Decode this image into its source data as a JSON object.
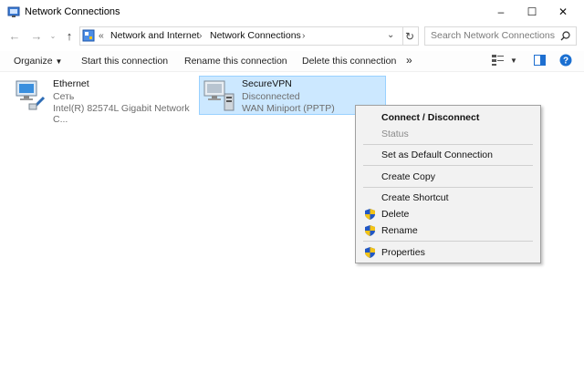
{
  "window": {
    "title": "Network Connections",
    "controls": {
      "minimize": "–",
      "maximize": "☐",
      "close": "✕"
    }
  },
  "address": {
    "overflow": "«",
    "crumbs": [
      "Network and Internet",
      "Network Connections"
    ],
    "separator": "›",
    "search_placeholder": "Search Network Connections"
  },
  "commands": {
    "organize": "Organize",
    "start": "Start this connection",
    "rename": "Rename this connection",
    "delete": "Delete this connection",
    "more": "»"
  },
  "items": [
    {
      "name": "Ethernet",
      "status": "Сеть",
      "device": "Intel(R) 82574L Gigabit Network C..."
    },
    {
      "name": "SecureVPN",
      "status": "Disconnected",
      "device": "WAN Miniport (PPTP)"
    }
  ],
  "context_menu": {
    "connect": "Connect / Disconnect",
    "status": "Status",
    "set_default": "Set as Default Connection",
    "create_copy": "Create Copy",
    "create_shortcut": "Create Shortcut",
    "delete": "Delete",
    "rename": "Rename",
    "properties": "Properties"
  },
  "colors": {
    "selection": "#cce8ff",
    "selection_border": "#99d1ff",
    "help_blue": "#1a6fd1",
    "shield_blue": "#2157c4",
    "shield_yellow": "#f3c316"
  }
}
